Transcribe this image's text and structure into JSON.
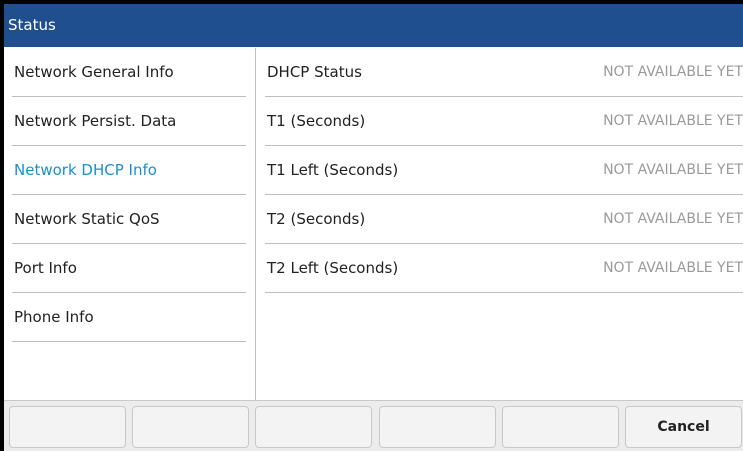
{
  "window": {
    "title": "Status"
  },
  "sidebar": {
    "items": [
      {
        "label": "Network General Info"
      },
      {
        "label": "Network Persist. Data"
      },
      {
        "label": "Network DHCP Info",
        "selected": true
      },
      {
        "label": "Network Static QoS"
      },
      {
        "label": "Port Info"
      },
      {
        "label": "Phone Info"
      }
    ]
  },
  "details": {
    "rows": [
      {
        "label": "DHCP Status",
        "value": "NOT AVAILABLE YET"
      },
      {
        "label": "T1 (Seconds)",
        "value": "NOT AVAILABLE YET"
      },
      {
        "label": "T1 Left (Seconds)",
        "value": "NOT AVAILABLE YET"
      },
      {
        "label": "T2 (Seconds)",
        "value": "NOT AVAILABLE YET"
      },
      {
        "label": "T2 Left (Seconds)",
        "value": "NOT AVAILABLE YET"
      }
    ]
  },
  "softkeys": [
    {
      "label": ""
    },
    {
      "label": ""
    },
    {
      "label": ""
    },
    {
      "label": ""
    },
    {
      "label": ""
    },
    {
      "label": "Cancel"
    }
  ],
  "colors": {
    "titlebar": "#1f4f8f",
    "selected_item": "#1a8fd0",
    "value_text": "#9a9a9a"
  }
}
